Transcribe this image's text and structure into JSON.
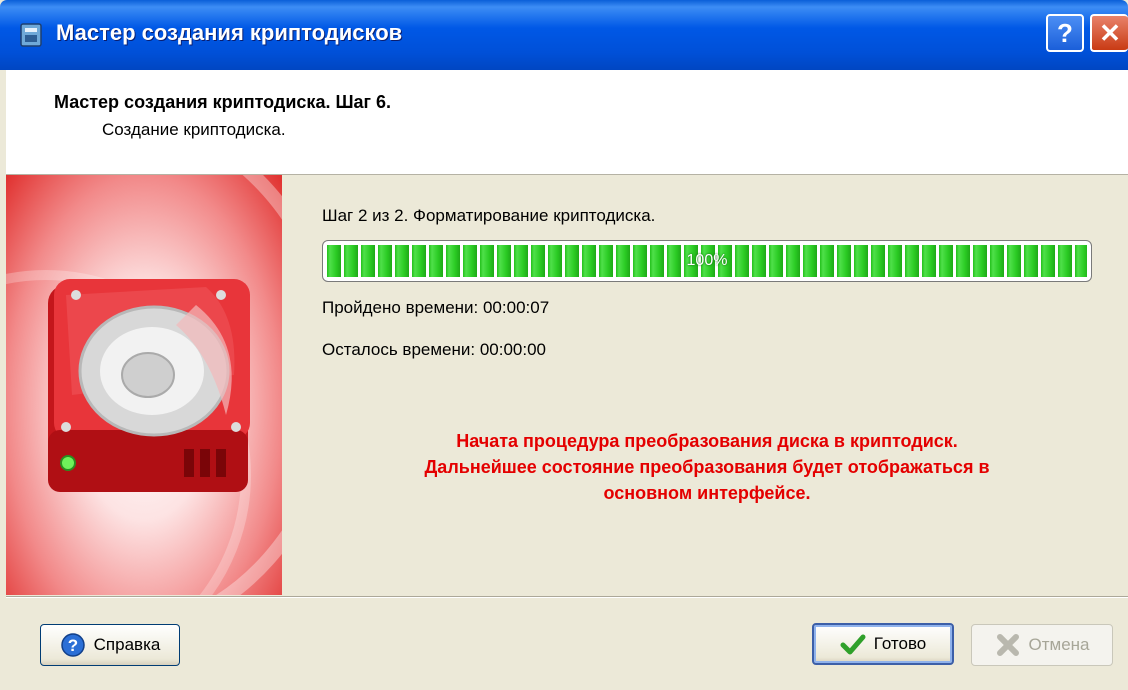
{
  "window": {
    "title": "Мастер создания криптодисков",
    "help_glyph": "?",
    "close_glyph": "✕"
  },
  "header": {
    "title": "Мастер создания криптодиска. Шаг 6.",
    "subtitle": "Создание криптодиска."
  },
  "content": {
    "step_text": "Шаг 2 из 2. Форматирование криптодиска.",
    "progress": {
      "percent": 100,
      "label": "100%"
    },
    "elapsed": "Пройдено времени:  00:00:07",
    "remaining": "Осталось времени:  00:00:00",
    "message_lines": [
      "Начата процедура преобразования диска в криптодиск.",
      "Дальнейшее состояние преобразования будет отображаться в",
      "основном интерфейсе."
    ]
  },
  "footer": {
    "help_label": "Справка",
    "done_label": "Готово",
    "cancel_label": "Отмена"
  },
  "icons": {
    "title": "app-icon",
    "side": "hard-disk-icon",
    "help": "help-question-icon",
    "done": "checkmark-icon",
    "cancel": "x-cross-icon"
  },
  "colors": {
    "titlebar": "#0058e6",
    "progress_fill": "#23c11b",
    "message": "#e40000",
    "dialog_bg": "#ece9d8"
  }
}
